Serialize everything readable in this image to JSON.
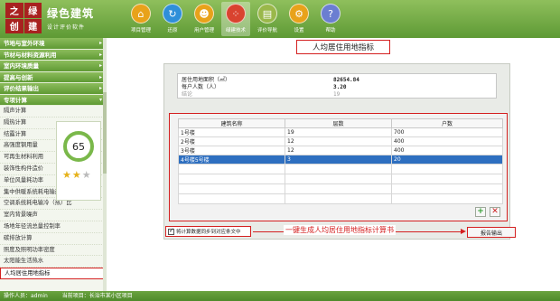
{
  "app": {
    "logo_chars": [
      "之",
      "绿",
      "创",
      "建"
    ],
    "name": "绿色建筑",
    "subtitle": "设计评价软件"
  },
  "toolbar": [
    {
      "label": "项目管理",
      "icon": "home-icon",
      "glyph": "⌂",
      "color": "#e8a21a"
    },
    {
      "label": "还原",
      "icon": "restore-icon",
      "glyph": "↻",
      "color": "#2f8fd9"
    },
    {
      "label": "用户管理",
      "icon": "user-icon",
      "glyph": "☻",
      "color": "#e8a21a"
    },
    {
      "label": "绿建技术",
      "icon": "dots-icon",
      "glyph": "⁘",
      "color": "#d9432f"
    },
    {
      "label": "评价导航",
      "icon": "chart-icon",
      "glyph": "▤",
      "color": "#9ab84a"
    },
    {
      "label": "设置",
      "icon": "gear-icon",
      "glyph": "⚙",
      "color": "#e8a21a"
    },
    {
      "label": "帮助",
      "icon": "help-icon",
      "glyph": "?",
      "color": "#6b7ed1"
    }
  ],
  "sidebar": {
    "groups": [
      "节地与室外环境",
      "节材与材料资源利用",
      "室内环境质量",
      "提高与创新",
      "评价结果输出",
      "专项计算"
    ],
    "items": [
      "隔声计算",
      "隔热计算",
      "结露计算",
      "高强度钢用量",
      "可再生材料利用",
      "装饰性构件造价",
      "单位风量耗功率",
      "集中供暖系统耗电输热比",
      "空调系统耗电输冷（热）比",
      "室内背景噪声",
      "场地年径流总量控制率",
      "碳排放计算",
      "照度及照明功率密度",
      "太阳能生活热水",
      "人均居住用地指标"
    ],
    "selected_item": "人均居住用地指标",
    "score": "65",
    "stars_on": 2,
    "stars_total": 3
  },
  "main": {
    "title": "人均居住用地指标",
    "info": [
      {
        "label": "居住用地面积（㎡）",
        "value": "82654.84"
      },
      {
        "label": "每户人数（人）",
        "value": "3.20"
      },
      {
        "label": "结论",
        "value": "19"
      }
    ],
    "table": {
      "headers": [
        "建筑名称",
        "层数",
        "户数"
      ],
      "rows": [
        [
          "1号楼",
          "19",
          "700"
        ],
        [
          "2号楼",
          "12",
          "400"
        ],
        [
          "3号楼",
          "12",
          "400"
        ],
        [
          "4号楼5号楼",
          "3",
          "20"
        ]
      ],
      "selected_row": 3,
      "empty_rows": 4
    },
    "sync_label": "将计算数据同步到对应条文中",
    "annotation": "一键生成人均居住用地指标计算书",
    "report_button": "报告输出"
  },
  "status": {
    "operator": "操作人员：admin",
    "project": "当前项目：长治市某小区项目"
  }
}
